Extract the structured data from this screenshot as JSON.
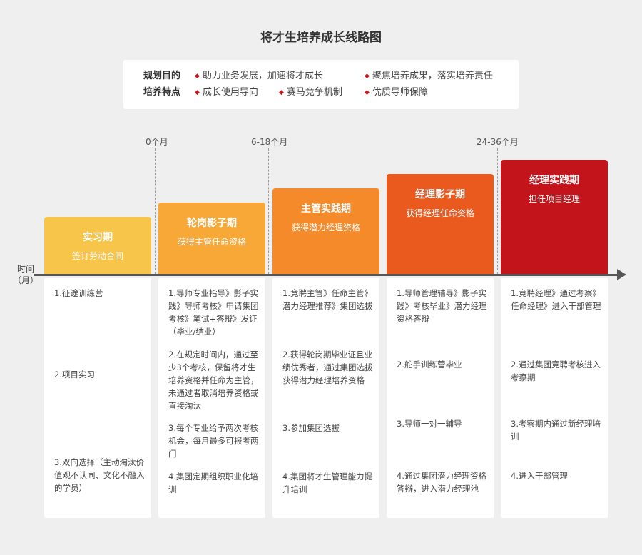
{
  "title": "将才生培养成长线路图",
  "summary": {
    "purpose_label": "规划目的",
    "purpose_items": [
      "助力业务发展，加速将才成长",
      "聚焦培养成果，落实培养责任"
    ],
    "feature_label": "培养特点",
    "feature_items": [
      "成长使用导向",
      "赛马竞争机制",
      "优质导师保障"
    ]
  },
  "timeline": {
    "axis_label_line1": "时间",
    "axis_label_line2": "（月）",
    "markers": [
      "0个月",
      "6-18个月",
      "24-36个月"
    ]
  },
  "colors": {
    "stage1": "#f7c54a",
    "stage2": "#f7a836",
    "stage3": "#f48a2a",
    "stage4": "#ea5a1f",
    "stage5": "#c2141a",
    "bullet": "#c8161d"
  },
  "stages": [
    {
      "name": "实习期",
      "subtitle": "签订劳动合同",
      "tasks": [
        "1.征途训练营",
        "2.项目实习",
        "3.双向选择（主动淘汰价值观不认同、文化不融入的学员）"
      ]
    },
    {
      "name": "轮岗影子期",
      "subtitle": "获得主管任命资格",
      "tasks": [
        "1.导师专业指导》影子实践》导师考核》申请集团考核》笔试+答辩》发证（毕业/结业）",
        "2.在规定时间内，通过至少3个考核，保留将才生培养资格并任命为主管，未通过者取消培养资格或直接淘汰",
        "3.每个专业给予两次考核机会，每月最多可报考两门",
        "4.集团定期组织职业化培训"
      ]
    },
    {
      "name": "主管实践期",
      "subtitle": "获得潜力经理资格",
      "tasks": [
        "1.竞聘主管》任命主管》潜力经理推荐》集团选拔",
        "2.获得轮岗期毕业证且业绩优秀者，通过集团选拔获得潜力经理培养资格",
        "3.参加集团选拔",
        "4.集团将才生管理能力提升培训"
      ]
    },
    {
      "name": "经理影子期",
      "subtitle": "获得经理任命资格",
      "tasks": [
        "1.导师管理辅导》影子实践》考核毕业》潜力经理资格答辩",
        "2.舵手训练营毕业",
        "3.导师一对一辅导",
        "4.通过集团潜力经理资格答辩，进入潜力经理池"
      ]
    },
    {
      "name": "经理实践期",
      "subtitle": "担任项目经理",
      "tasks": [
        "1.竞聘经理》通过考察》任命经理》进入干部管理",
        "2.通过集团竞聘考核进入考察期",
        "3.考察期内通过新经理培训",
        "4.进入干部管理"
      ]
    }
  ]
}
